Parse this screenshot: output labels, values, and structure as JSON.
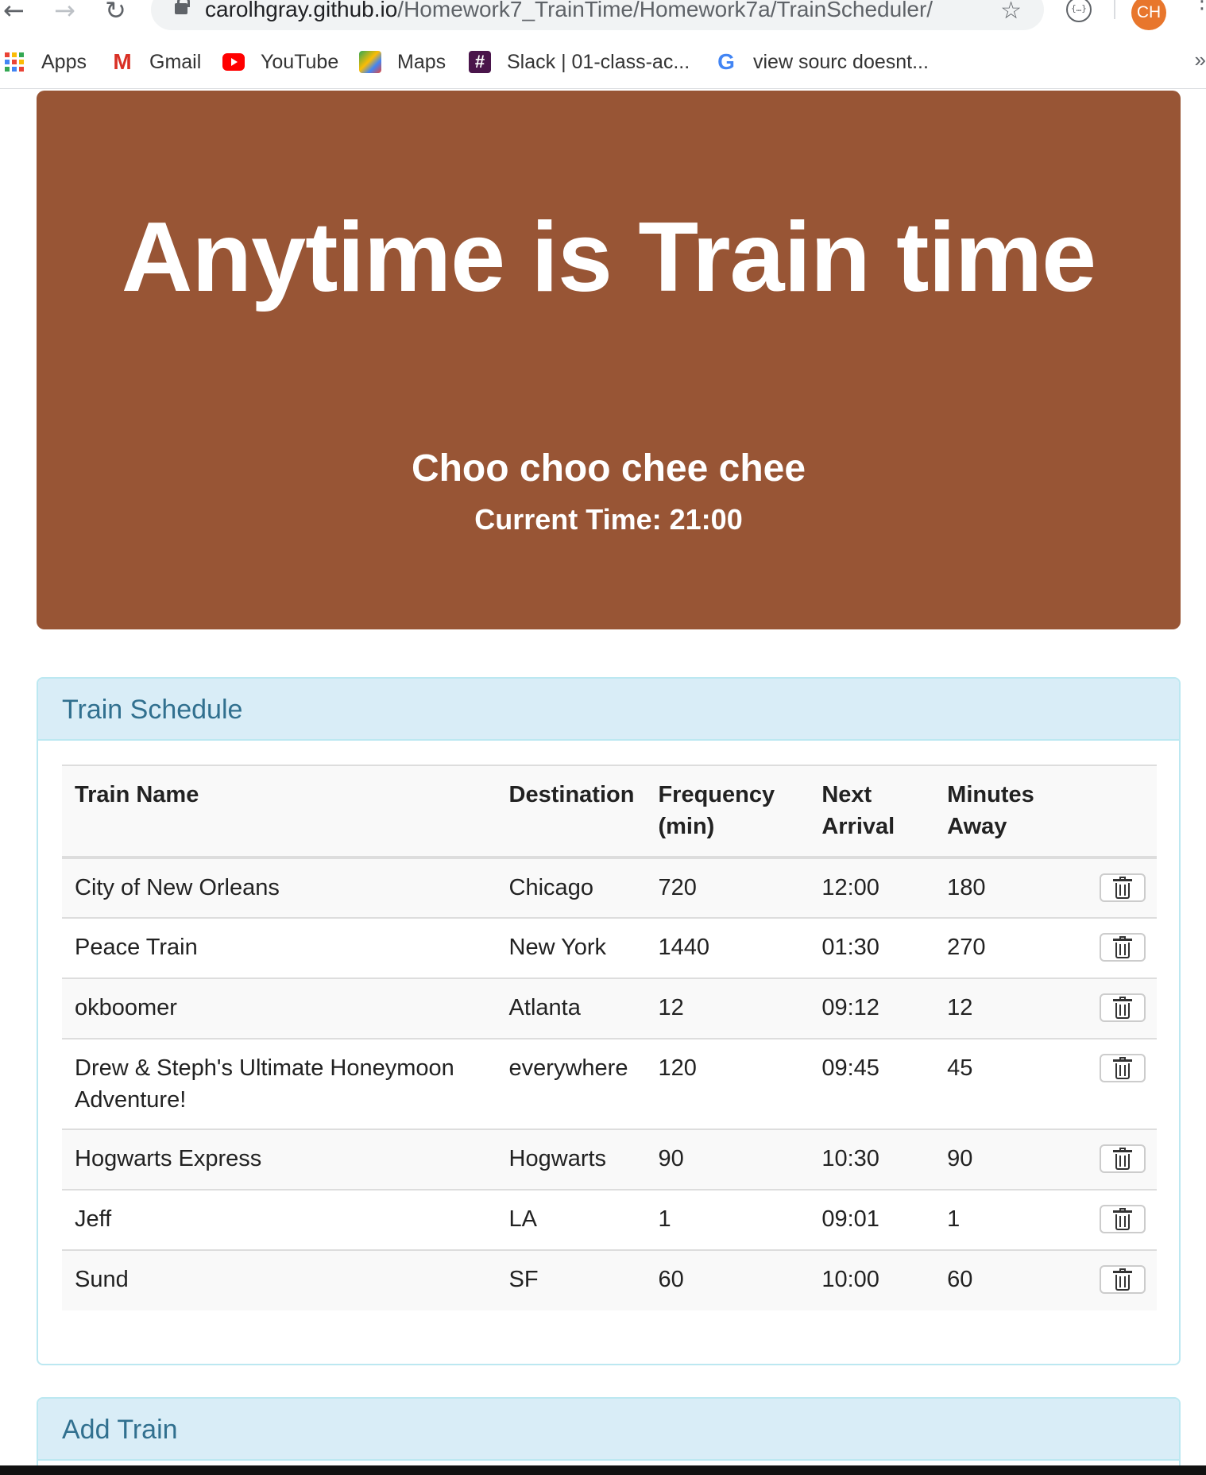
{
  "browser": {
    "url_host": "carolhgray.github.io",
    "url_path": "/Homework7_TrainTime/Homework7a/TrainScheduler/",
    "avatar_initials": "CH",
    "bookmarks": [
      {
        "label": "Apps",
        "icon": "apps-grid-icon"
      },
      {
        "label": "Gmail",
        "icon": "gmail-icon"
      },
      {
        "label": "YouTube",
        "icon": "youtube-icon"
      },
      {
        "label": "Maps",
        "icon": "maps-icon"
      },
      {
        "label": "Slack | 01-class-ac...",
        "icon": "slack-icon"
      },
      {
        "label": "view sourc doesnt...",
        "icon": "google-icon"
      }
    ],
    "more_label": "»"
  },
  "jumbotron": {
    "title": "Anytime is Train time",
    "subtitle": "Choo choo chee chee",
    "current_time": "Current Time: 21:00",
    "background": "#985535"
  },
  "schedule": {
    "title": "Train Schedule",
    "columns": [
      "Train Name",
      "Destination",
      "Frequency (min)",
      "Next Arrival",
      "Minutes Away"
    ],
    "rows": [
      {
        "name": "City of New Orleans",
        "destination": "Chicago",
        "frequency": "720",
        "next_arrival": "12:00",
        "minutes_away": "180"
      },
      {
        "name": "Peace Train",
        "destination": "New York",
        "frequency": "1440",
        "next_arrival": "01:30",
        "minutes_away": "270"
      },
      {
        "name": "okboomer",
        "destination": "Atlanta",
        "frequency": "12",
        "next_arrival": "09:12",
        "minutes_away": "12"
      },
      {
        "name": "Drew & Steph's Ultimate Honeymoon Adventure!",
        "destination": "everywhere",
        "frequency": "120",
        "next_arrival": "09:45",
        "minutes_away": "45"
      },
      {
        "name": "Hogwarts Express",
        "destination": "Hogwarts",
        "frequency": "90",
        "next_arrival": "10:30",
        "minutes_away": "90"
      },
      {
        "name": "Jeff",
        "destination": "LA",
        "frequency": "1",
        "next_arrival": "09:01",
        "minutes_away": "1"
      },
      {
        "name": "Sund",
        "destination": "SF",
        "frequency": "60",
        "next_arrival": "10:00",
        "minutes_away": "60"
      }
    ]
  },
  "add_train": {
    "title": "Add Train"
  },
  "colors": {
    "panel_heading_bg": "#d9edf7",
    "panel_border": "#bce8f1",
    "panel_title": "#31708f"
  }
}
